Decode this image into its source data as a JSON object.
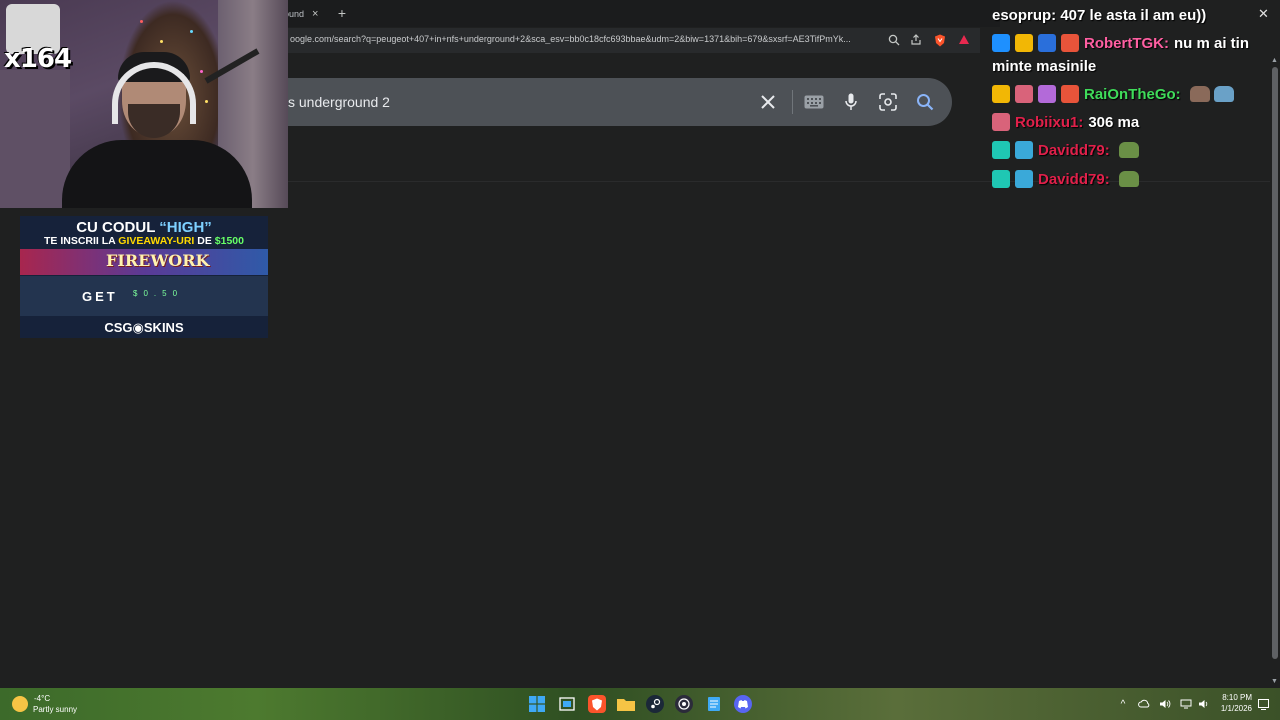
{
  "browser": {
    "tab_title": "ound",
    "tab_close": "×",
    "new_tab": "+",
    "url": "oogle.com/search?q=peugeot+407+in+nfs+underground+2&sca_esv=bb0c18cfc693bbae&udm=2&biw=1371&bih=679&sxsrf=AE3TifPmYk..."
  },
  "search": {
    "query": "s underground 2",
    "clear_glyph": "✕"
  },
  "webcam": {
    "counter": "x164"
  },
  "banner": {
    "line1_a": "CU CODUL ",
    "line1_b": "“HIGH”",
    "line2_a": "TE INSCRII LA ",
    "line2_b": "GIVEAWAY-URI",
    "line2_c": " DE ",
    "line2_d": "$1500",
    "game": "FIREWORK",
    "get": "GET",
    "amount": "$0.50",
    "brand": "CSG◉SKINS"
  },
  "chat": {
    "header": "esoprup: 407 le asta il am eu))",
    "close_glyph": "✕",
    "messages": [
      {
        "user": "RobertTGK:",
        "text": "nu m ai tin",
        "text_wrap": "minte masinile",
        "color": "#ff5fa2"
      },
      {
        "user": "RaiOnTheGo:",
        "text": "",
        "color": "#3fdc5a"
      },
      {
        "user": "Robiixu1:",
        "text": "306 ma",
        "color": "#e0204a"
      },
      {
        "user": "Davidd79:",
        "text": "",
        "color": "#e0204a"
      },
      {
        "user": "Davidd79:",
        "text": "",
        "color": "#e0204a"
      }
    ]
  },
  "taskbar": {
    "weather_temp": "-4°C",
    "weather_desc": "Partly sunny",
    "time": "8:10 PM",
    "date": "1/1/2026",
    "tray_up": "^"
  },
  "colors": {
    "page_bg": "#1f2020",
    "search_bg": "#4d5156",
    "brave_orange": "#fb542b",
    "windows_blue": "#1c9bf0",
    "discord": "#5865f2"
  }
}
